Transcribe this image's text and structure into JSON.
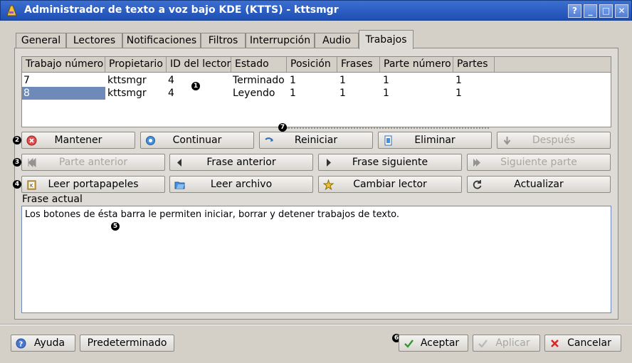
{
  "window": {
    "title": "Administrador de texto a voz bajo KDE (KTTS) - kttsmgr",
    "controls": [
      "?",
      "_",
      "□",
      "✕"
    ]
  },
  "tabs": [
    {
      "label": "General"
    },
    {
      "label": "Lectores"
    },
    {
      "label": "Notificaciones"
    },
    {
      "label": "Filtros"
    },
    {
      "label": "Interrupción"
    },
    {
      "label": "Audio"
    },
    {
      "label": "Trabajos"
    }
  ],
  "jobs_table": {
    "columns": [
      "Trabajo número",
      "Propietario",
      "ID del lector",
      "Estado",
      "Posición",
      "Frases",
      "Parte número",
      "Partes"
    ],
    "rows": [
      [
        "7",
        "kttsmgr",
        "4",
        "Terminado",
        "1",
        "1",
        "1",
        "1"
      ],
      [
        "8",
        "kttsmgr",
        "4",
        "Leyendo",
        "1",
        "1",
        "1",
        "1"
      ]
    ]
  },
  "callouts": [
    "1",
    "2",
    "3",
    "4",
    "5",
    "6",
    "7"
  ],
  "buttons": {
    "mantener": "Mantener",
    "continuar": "Continuar",
    "reiniciar": "Reiniciar",
    "eliminar": "Eliminar",
    "despues": "Después",
    "parte_anterior": "Parte anterior",
    "frase_anterior": "Frase anterior",
    "frase_siguiente": "Frase siguiente",
    "siguiente_parte": "Siguiente parte",
    "leer_portapapeles": "Leer portapapeles",
    "leer_archivo": "Leer archivo",
    "cambiar_lector": "Cambiar lector",
    "actualizar": "Actualizar"
  },
  "current_sentence": {
    "label": "Frase actual",
    "text": "Los botones de ésta barra le permiten iniciar, borrar y detener trabajos de texto."
  },
  "footer": {
    "ayuda": "Ayuda",
    "predeterminado": "Predeterminado",
    "aceptar": "Aceptar",
    "aplicar": "Aplicar",
    "cancelar": "Cancelar"
  },
  "colors": {
    "titlebar": "#2a5cc4",
    "selection": "#6e8ab8",
    "panel": "#dedbd6"
  }
}
